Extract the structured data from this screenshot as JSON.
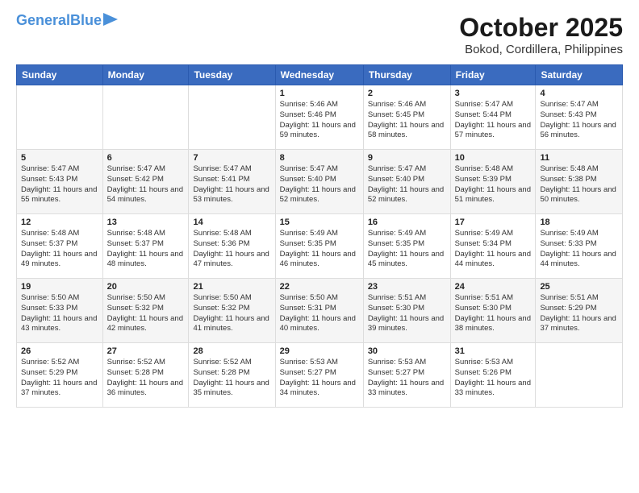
{
  "logo": {
    "line1": "General",
    "line2": "Blue"
  },
  "title": "October 2025",
  "location": "Bokod, Cordillera, Philippines",
  "weekdays": [
    "Sunday",
    "Monday",
    "Tuesday",
    "Wednesday",
    "Thursday",
    "Friday",
    "Saturday"
  ],
  "weeks": [
    [
      {
        "day": "",
        "text": ""
      },
      {
        "day": "",
        "text": ""
      },
      {
        "day": "",
        "text": ""
      },
      {
        "day": "1",
        "text": "Sunrise: 5:46 AM\nSunset: 5:46 PM\nDaylight: 11 hours\nand 59 minutes."
      },
      {
        "day": "2",
        "text": "Sunrise: 5:46 AM\nSunset: 5:45 PM\nDaylight: 11 hours\nand 58 minutes."
      },
      {
        "day": "3",
        "text": "Sunrise: 5:47 AM\nSunset: 5:44 PM\nDaylight: 11 hours\nand 57 minutes."
      },
      {
        "day": "4",
        "text": "Sunrise: 5:47 AM\nSunset: 5:43 PM\nDaylight: 11 hours\nand 56 minutes."
      }
    ],
    [
      {
        "day": "5",
        "text": "Sunrise: 5:47 AM\nSunset: 5:43 PM\nDaylight: 11 hours\nand 55 minutes."
      },
      {
        "day": "6",
        "text": "Sunrise: 5:47 AM\nSunset: 5:42 PM\nDaylight: 11 hours\nand 54 minutes."
      },
      {
        "day": "7",
        "text": "Sunrise: 5:47 AM\nSunset: 5:41 PM\nDaylight: 11 hours\nand 53 minutes."
      },
      {
        "day": "8",
        "text": "Sunrise: 5:47 AM\nSunset: 5:40 PM\nDaylight: 11 hours\nand 52 minutes."
      },
      {
        "day": "9",
        "text": "Sunrise: 5:47 AM\nSunset: 5:40 PM\nDaylight: 11 hours\nand 52 minutes."
      },
      {
        "day": "10",
        "text": "Sunrise: 5:48 AM\nSunset: 5:39 PM\nDaylight: 11 hours\nand 51 minutes."
      },
      {
        "day": "11",
        "text": "Sunrise: 5:48 AM\nSunset: 5:38 PM\nDaylight: 11 hours\nand 50 minutes."
      }
    ],
    [
      {
        "day": "12",
        "text": "Sunrise: 5:48 AM\nSunset: 5:37 PM\nDaylight: 11 hours\nand 49 minutes."
      },
      {
        "day": "13",
        "text": "Sunrise: 5:48 AM\nSunset: 5:37 PM\nDaylight: 11 hours\nand 48 minutes."
      },
      {
        "day": "14",
        "text": "Sunrise: 5:48 AM\nSunset: 5:36 PM\nDaylight: 11 hours\nand 47 minutes."
      },
      {
        "day": "15",
        "text": "Sunrise: 5:49 AM\nSunset: 5:35 PM\nDaylight: 11 hours\nand 46 minutes."
      },
      {
        "day": "16",
        "text": "Sunrise: 5:49 AM\nSunset: 5:35 PM\nDaylight: 11 hours\nand 45 minutes."
      },
      {
        "day": "17",
        "text": "Sunrise: 5:49 AM\nSunset: 5:34 PM\nDaylight: 11 hours\nand 44 minutes."
      },
      {
        "day": "18",
        "text": "Sunrise: 5:49 AM\nSunset: 5:33 PM\nDaylight: 11 hours\nand 44 minutes."
      }
    ],
    [
      {
        "day": "19",
        "text": "Sunrise: 5:50 AM\nSunset: 5:33 PM\nDaylight: 11 hours\nand 43 minutes."
      },
      {
        "day": "20",
        "text": "Sunrise: 5:50 AM\nSunset: 5:32 PM\nDaylight: 11 hours\nand 42 minutes."
      },
      {
        "day": "21",
        "text": "Sunrise: 5:50 AM\nSunset: 5:32 PM\nDaylight: 11 hours\nand 41 minutes."
      },
      {
        "day": "22",
        "text": "Sunrise: 5:50 AM\nSunset: 5:31 PM\nDaylight: 11 hours\nand 40 minutes."
      },
      {
        "day": "23",
        "text": "Sunrise: 5:51 AM\nSunset: 5:30 PM\nDaylight: 11 hours\nand 39 minutes."
      },
      {
        "day": "24",
        "text": "Sunrise: 5:51 AM\nSunset: 5:30 PM\nDaylight: 11 hours\nand 38 minutes."
      },
      {
        "day": "25",
        "text": "Sunrise: 5:51 AM\nSunset: 5:29 PM\nDaylight: 11 hours\nand 37 minutes."
      }
    ],
    [
      {
        "day": "26",
        "text": "Sunrise: 5:52 AM\nSunset: 5:29 PM\nDaylight: 11 hours\nand 37 minutes."
      },
      {
        "day": "27",
        "text": "Sunrise: 5:52 AM\nSunset: 5:28 PM\nDaylight: 11 hours\nand 36 minutes."
      },
      {
        "day": "28",
        "text": "Sunrise: 5:52 AM\nSunset: 5:28 PM\nDaylight: 11 hours\nand 35 minutes."
      },
      {
        "day": "29",
        "text": "Sunrise: 5:53 AM\nSunset: 5:27 PM\nDaylight: 11 hours\nand 34 minutes."
      },
      {
        "day": "30",
        "text": "Sunrise: 5:53 AM\nSunset: 5:27 PM\nDaylight: 11 hours\nand 33 minutes."
      },
      {
        "day": "31",
        "text": "Sunrise: 5:53 AM\nSunset: 5:26 PM\nDaylight: 11 hours\nand 33 minutes."
      },
      {
        "day": "",
        "text": ""
      }
    ]
  ]
}
